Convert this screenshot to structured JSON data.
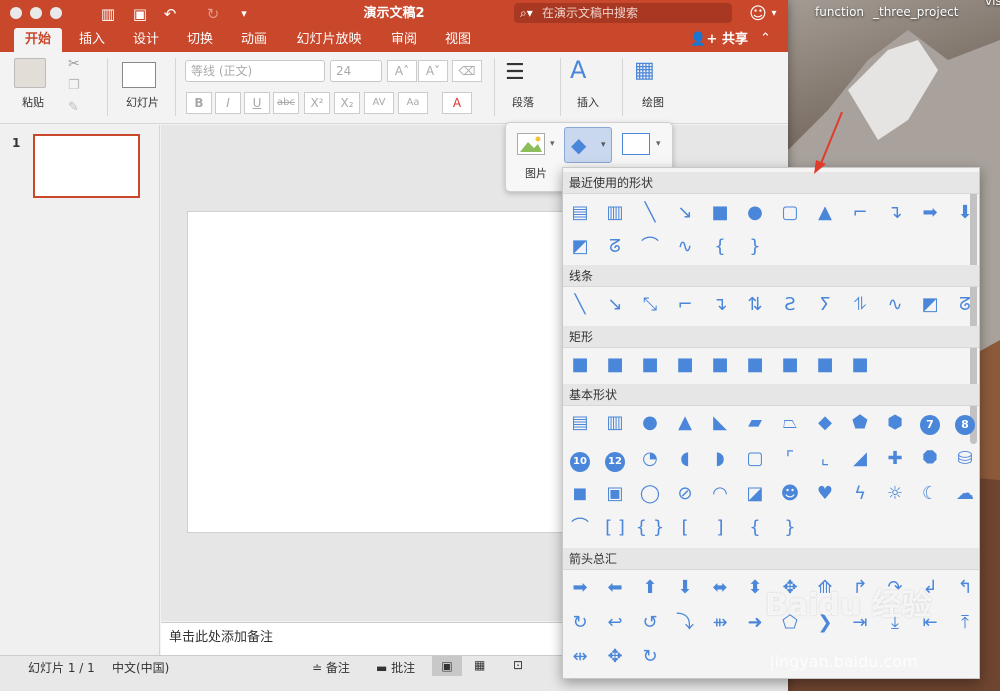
{
  "desktop": {
    "labels": [
      "function",
      "_three_project",
      "vis"
    ]
  },
  "titlebar": {
    "title": "演示文稿2",
    "search_placeholder": "在演示文稿中搜索"
  },
  "tabs": [
    {
      "label": "开始",
      "active": true
    },
    {
      "label": "插入"
    },
    {
      "label": "设计"
    },
    {
      "label": "切换"
    },
    {
      "label": "动画"
    },
    {
      "label": "幻灯片放映"
    },
    {
      "label": "审阅"
    },
    {
      "label": "视图"
    }
  ],
  "share": {
    "label": "共享"
  },
  "ribbon": {
    "paste": "粘贴",
    "slides": "幻灯片",
    "font_name": "等线 (正文)",
    "font_size": "24",
    "paragraph": "段落",
    "insert": "插入",
    "drawing": "绘图"
  },
  "insert_popup": {
    "picture": "图片"
  },
  "thumbnail": {
    "number": "1"
  },
  "notes": {
    "placeholder": "单击此处添加备注"
  },
  "status": {
    "slide_count": "幻灯片 1 / 1",
    "language": "中文(中国)",
    "notes": "备注",
    "comments": "批注"
  },
  "shapes_menu": {
    "sections": [
      "最近使用的形状",
      "线条",
      "矩形",
      "基本形状",
      "箭头总汇"
    ],
    "numbered": [
      "7",
      "8",
      "10",
      "12"
    ]
  },
  "watermark": {
    "brand": "Baidu 经验",
    "url": "jingyan.baidu.com"
  }
}
